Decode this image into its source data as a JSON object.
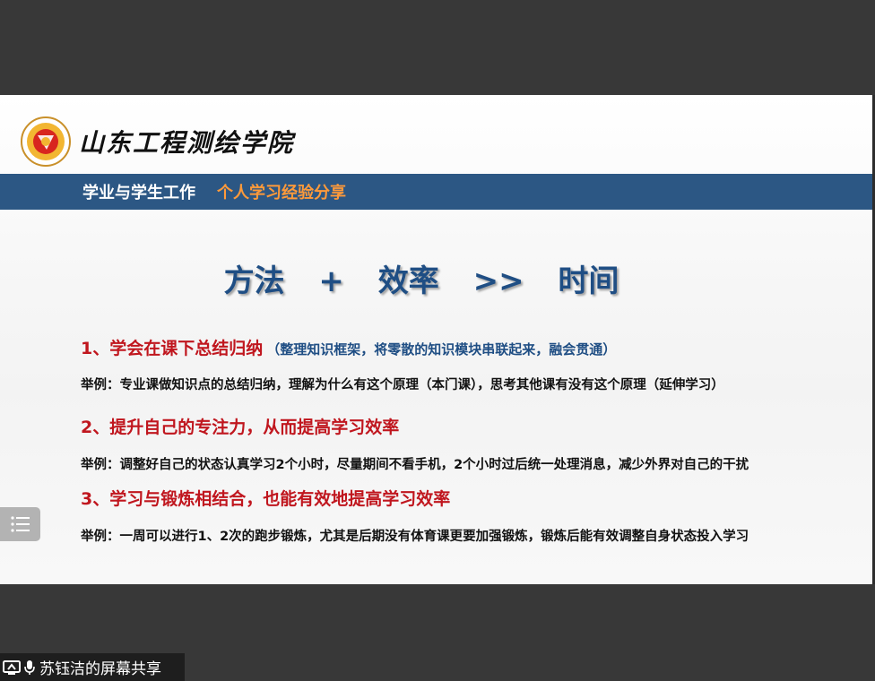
{
  "slide": {
    "school_name": "山东工程测绘学院",
    "banner": {
      "section": "学业与学生工作",
      "topic": "个人学习经验分享"
    },
    "headline": {
      "part1": "方法",
      "op1": "+",
      "part2": "效率",
      "op2": ">>",
      "part3": "时间"
    },
    "points": [
      {
        "title": "1、学会在课下总结归纳",
        "note": "（整理知识框架，将零散的知识模块串联起来，融会贯通）",
        "example": "举例：专业课做知识点的总结归纳，理解为什么有这个原理（本门课），思考其他课有没有这个原理（延伸学习）"
      },
      {
        "title": "2、提升自己的专注力，从而提高学习效率",
        "note": "",
        "example": "举例：调整好自己的状态认真学习2个小时，尽量期间不看手机，2个小时过后统一处理消息，减少外界对自己的干扰"
      },
      {
        "title": "3、学习与锻炼相结合，也能有效地提高学习效率",
        "note": "",
        "example": "举例：一周可以进行1、2次的跑步锻炼，尤其是后期没有体育课更要加强锻炼，锻炼后能有效调整自身状态投入学习"
      }
    ]
  },
  "screen_share": {
    "label": "苏钰洁的屏幕共享"
  },
  "colors": {
    "banner_bg": "#2c5784",
    "banner_topic": "#ff9a3a",
    "headline": "#1f4e84",
    "point_title": "#c0161e",
    "background": "#383838"
  },
  "icons": {
    "menu": "menu-lines-icon",
    "share": "screen-share-icon",
    "mic": "microphone-icon",
    "logo": "school-logo-icon"
  }
}
